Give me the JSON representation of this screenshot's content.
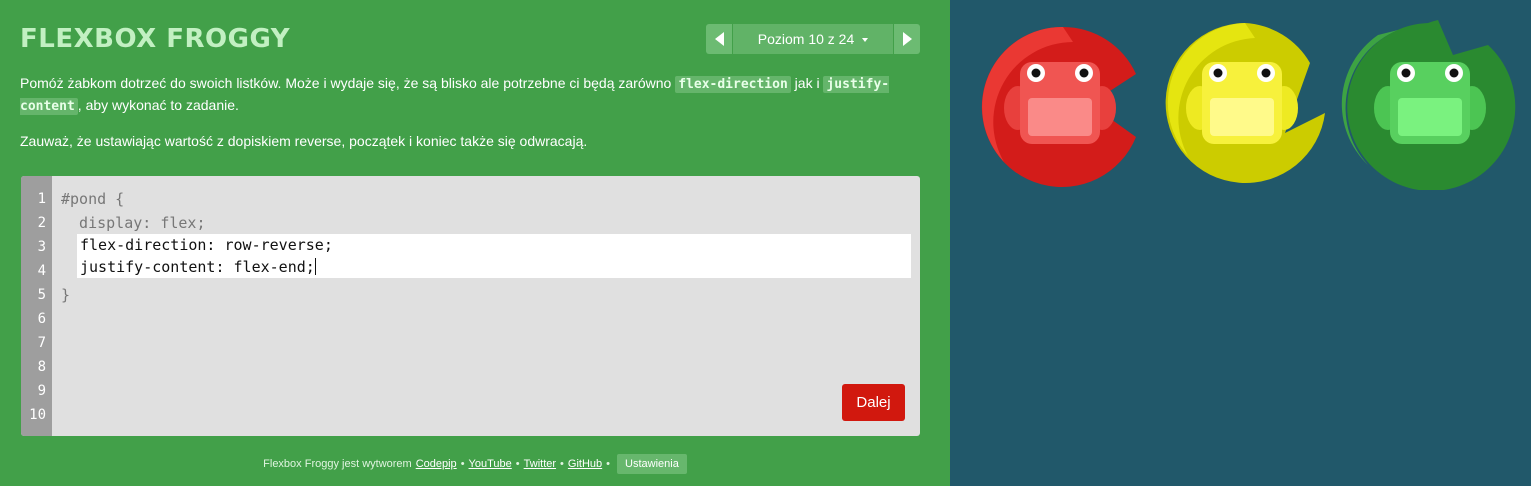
{
  "header": {
    "title": "FLEXBOX FROGGY",
    "level_label": "Poziom 10 z 24"
  },
  "instructions": {
    "p1_before": "Pomóż żabkom dotrzeć do swoich listków. Może i wydaje się, że są blisko ale potrzebne ci będą zarówno ",
    "code1": "flex-direction",
    "p1_middle": " jak i ",
    "code2": "justify-content",
    "p1_after": ", aby wykonać to zadanie.",
    "p2": "Zauważ, że ustawiając wartość z dopiskiem reverse, początek i koniec także się odwracają."
  },
  "editor": {
    "line_numbers": [
      "1",
      "2",
      "3",
      "4",
      "5",
      "6",
      "7",
      "8",
      "9",
      "10"
    ],
    "line1": "#pond {",
    "line2": "  display: flex;",
    "input_line1": "flex-direction: row-reverse;",
    "input_line2": "justify-content: flex-end;",
    "line5": "}",
    "next_label": "Dalej"
  },
  "footer": {
    "prefix": "Flexbox Froggy jest wytworem",
    "links": [
      "Codepip",
      "YouTube",
      "Twitter",
      "GitHub"
    ],
    "separator": "•",
    "settings_label": "Ustawienia"
  },
  "board": {
    "frogs": [
      {
        "color": "red",
        "body": "#f05552",
        "pad": "#d31c1a"
      },
      {
        "color": "yellow",
        "body": "#f7f13c",
        "pad": "#cccc00"
      },
      {
        "color": "green",
        "body": "#58d05f",
        "pad": "#2a8a30"
      }
    ]
  }
}
